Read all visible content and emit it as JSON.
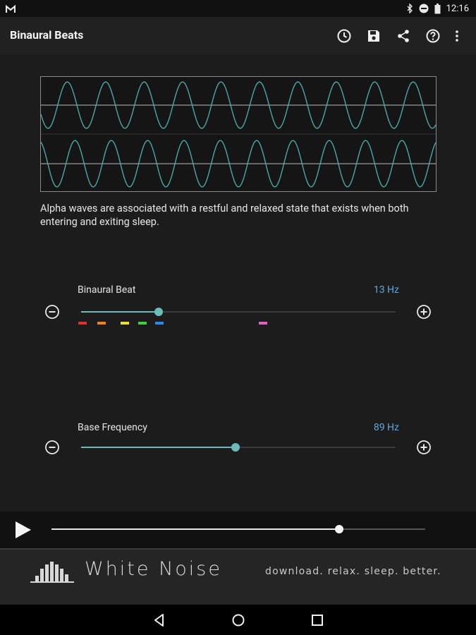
{
  "status_bar": {
    "time": "12:16",
    "icons": [
      "gmail-icon",
      "bluetooth-icon",
      "do-not-disturb-icon",
      "battery-icon"
    ]
  },
  "app_bar": {
    "title": "Binaural Beats",
    "actions": [
      "timer-icon",
      "save-icon",
      "share-icon",
      "help-icon",
      "overflow-menu-icon"
    ]
  },
  "description": "Alpha waves are associated with a restful and relaxed state that exists when both entering and exiting sleep.",
  "binaural_beat": {
    "label": "Binaural Beat",
    "value": "13 Hz",
    "fraction": 0.246,
    "marker_colors": [
      "#e03030",
      "#f08020",
      "#e8e030",
      "#40d040",
      "#2a8ae8",
      "#e060c0"
    ]
  },
  "base_frequency": {
    "label": "Base Frequency",
    "value": "89 Hz",
    "fraction": 0.49
  },
  "player": {
    "progress": 0.77
  },
  "banner": {
    "title": "White Noise",
    "tagline": "download. relax. sleep. better."
  },
  "nav_bar": {
    "buttons": [
      "back-icon",
      "home-icon",
      "recents-icon"
    ]
  },
  "colors": {
    "accent": "#6bbcb8",
    "value_text": "#5ea8e0",
    "wave": "#4aa8a8"
  }
}
